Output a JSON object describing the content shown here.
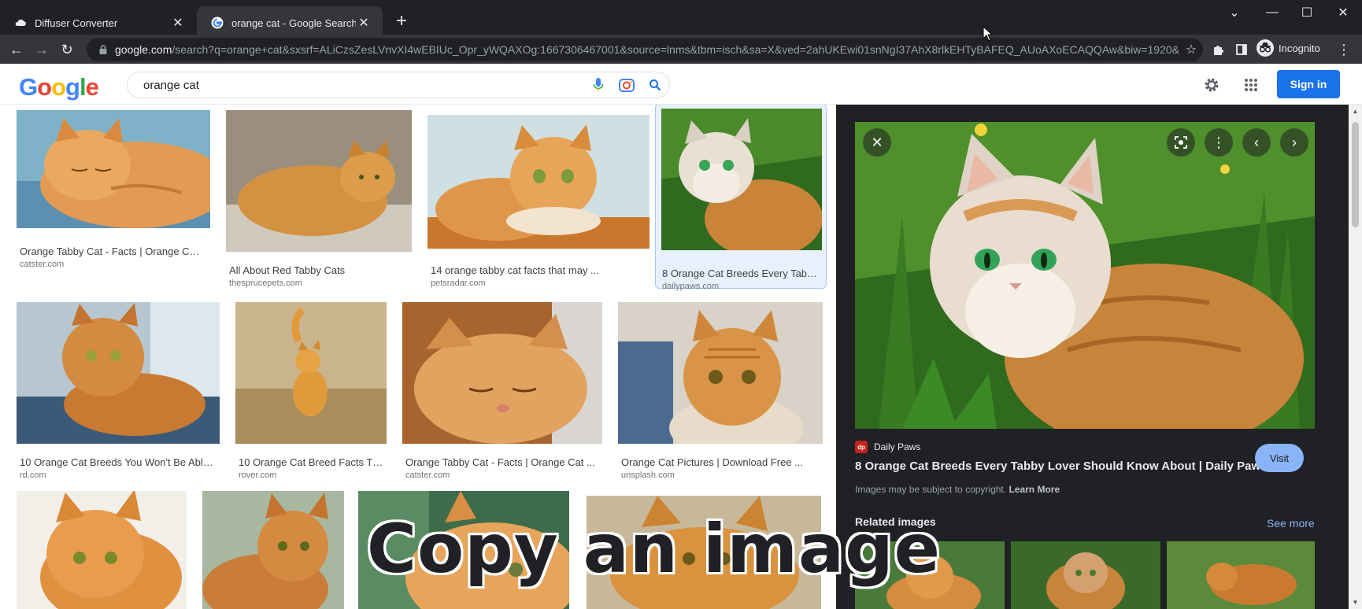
{
  "browser": {
    "tabs": [
      {
        "title": "Diffuser Converter",
        "active": false
      },
      {
        "title": "orange cat - Google Search",
        "active": true
      }
    ],
    "url_host": "google.com",
    "url_rest": "/search?q=orange+cat&sxsrf=ALiCzsZesLVnvXI4wEBIUc_Opr_yWQAXOg:1667306467001&source=lnms&tbm=isch&sa=X&ved=2ahUKEwi01snNgI37AhX8rlkEHTyBAFEQ_AUoAXoECAQQAw&biw=1920&bih...",
    "profile_label": "Incognito"
  },
  "header": {
    "logo": "Google",
    "search_value": "orange cat",
    "signin_label": "Sign in"
  },
  "results": [
    {
      "title": "Orange Tabby Cat - Facts | Orange Cat ...",
      "source": "catster.com"
    },
    {
      "title": "All About Red Tabby Cats",
      "source": "thesprucepets.com"
    },
    {
      "title": "14 orange tabby cat facts that may ...",
      "source": "petsradar.com"
    },
    {
      "title": "8 Orange Cat Breeds Every Tabby ...",
      "source": "dailypaws.com"
    },
    {
      "title": "10 Orange Cat Breeds You Won't Be Able ...",
      "source": "rd.com"
    },
    {
      "title": "10 Orange Cat Breed Facts That...",
      "source": "rover.com"
    },
    {
      "title": "Orange Tabby Cat - Facts | Orange Cat ...",
      "source": "catster.com"
    },
    {
      "title": "Orange Cat Pictures | Download Free ...",
      "source": "unsplash.com"
    }
  ],
  "preview": {
    "source_name": "Daily Paws",
    "title": "8 Orange Cat Breeds Every Tabby Lover Should Know About | Daily Paws",
    "visit_label": "Visit",
    "copyright_note": "Images may be subject to copyright.",
    "learn_more": "Learn More",
    "related_label": "Related images",
    "see_more_label": "See more"
  },
  "overlay_caption": "Copy an image",
  "colors": {
    "chrome_dark": "#202124",
    "chrome_toolbar": "#35363a",
    "google_blue": "#4285f4",
    "google_red": "#ea4335",
    "google_yellow": "#fbbc05",
    "google_green": "#34a853",
    "signin_blue": "#1a73e8",
    "visit_blue": "#8ab4f8"
  }
}
